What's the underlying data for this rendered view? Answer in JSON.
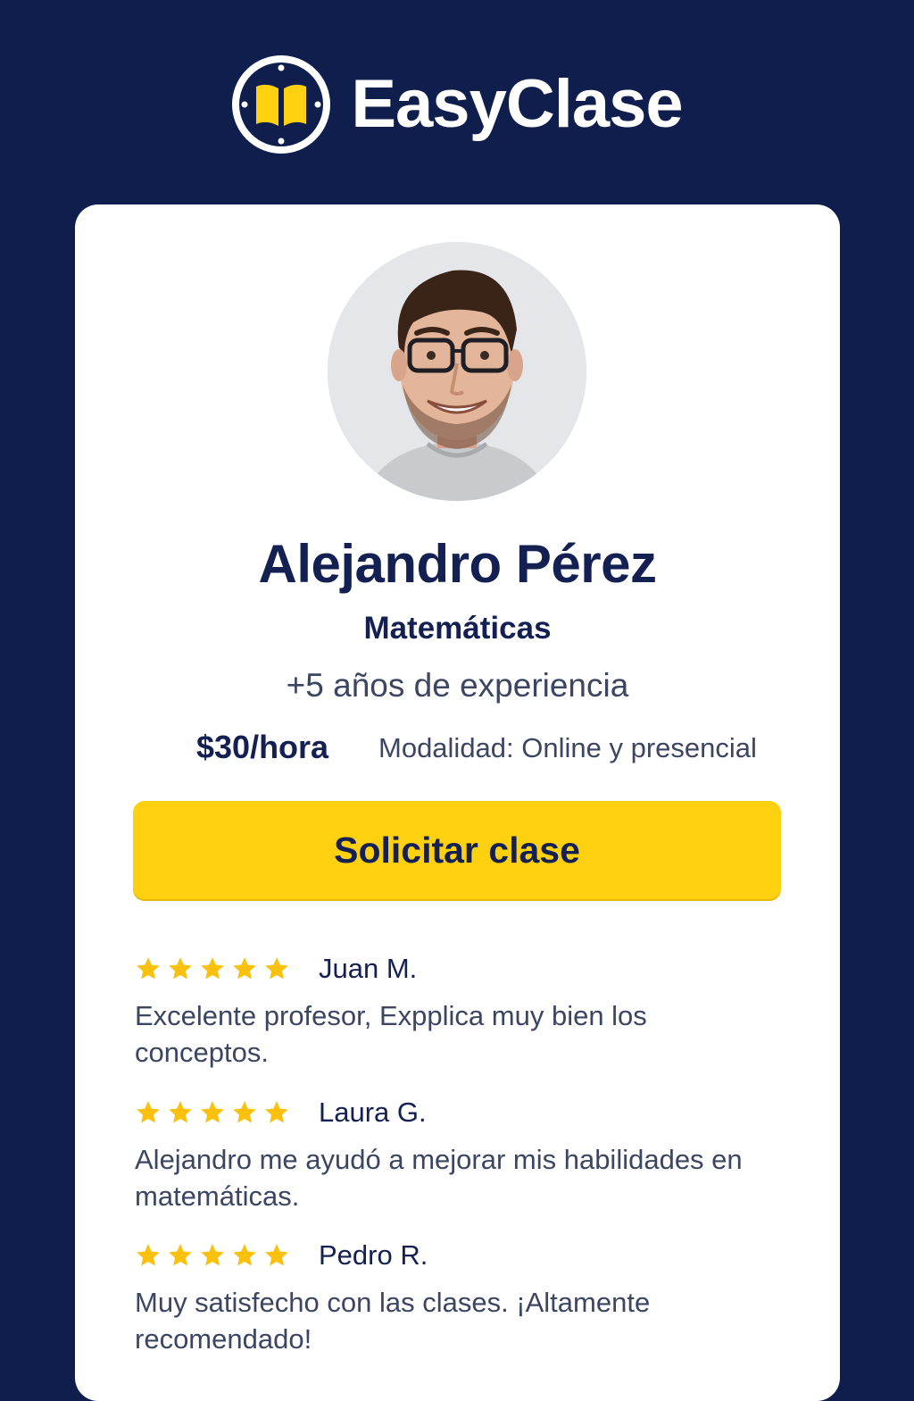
{
  "brand": {
    "name": "EasyClase",
    "logo_icon": "open-book-icon"
  },
  "colors": {
    "background": "#0f1e4d",
    "card": "#ffffff",
    "accent": "#fdd10f",
    "text_primary": "#142052",
    "text_secondary": "#3c4562",
    "star": "#f9c10b"
  },
  "tutor": {
    "name": "Alejandro Pérez",
    "subject": "Matemáticas",
    "experience": "+5 años de experiencia",
    "price": "$30/hora",
    "modality": "Modalidad: Online y presencial"
  },
  "cta": {
    "label": "Solicitar clase"
  },
  "reviews": [
    {
      "rating": 5,
      "author": "Juan M.",
      "text": "Excelente profesor, Expplica muy bien los conceptos."
    },
    {
      "rating": 5,
      "author": "Laura G.",
      "text": "Alejandro me ayudó a mejorar mis habilidades en matemáticas."
    },
    {
      "rating": 5,
      "author": "Pedro R.",
      "text": "Muy satisfecho con las clases. ¡Altamente recomendado!"
    }
  ]
}
